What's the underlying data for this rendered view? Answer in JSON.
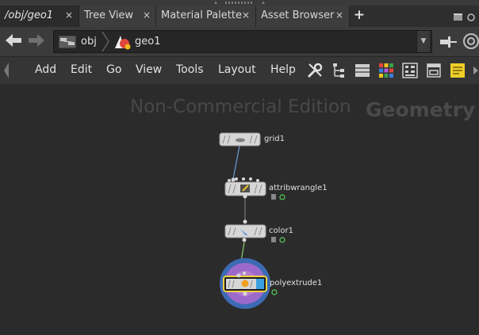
{
  "tabs": [
    {
      "label": "/obj/geo1",
      "active": true
    },
    {
      "label": "Tree View",
      "active": false
    },
    {
      "label": "Material Palette",
      "active": false
    },
    {
      "label": "Asset Browser",
      "active": false
    }
  ],
  "tab_close_glyph": "×",
  "add_tab_glyph": "+",
  "path": {
    "crumbs": [
      "obj",
      "geo1"
    ],
    "dropdown_glyph": "▼"
  },
  "menu": [
    "Add",
    "Edit",
    "Go",
    "View",
    "Tools",
    "Layout",
    "Help"
  ],
  "watermark": {
    "edition": "Non-Commercial Edition",
    "context": "Geometry"
  },
  "nodes": [
    {
      "name": "grid1"
    },
    {
      "name": "attribwrangle1"
    },
    {
      "name": "color1"
    },
    {
      "name": "polyextrude1",
      "selected": true,
      "display": true
    }
  ],
  "colors": {
    "display_flag": "#3aa0e0",
    "selected_outline": "#f0d23c",
    "render_ring": "#3c6bb4",
    "template_ring": "#9b6acb",
    "wire_green": "#8fd06a",
    "wire_blue": "#6f9ad8"
  },
  "icons": [
    "back-arrow-icon",
    "forward-arrow-icon",
    "network-icon",
    "geo-object-icon",
    "wrench-screwdriver-icon",
    "tree-layout-icon",
    "list-view-icon",
    "color-grid-icon",
    "thumbnail-view-icon",
    "window-icon",
    "sticky-note-icon"
  ]
}
